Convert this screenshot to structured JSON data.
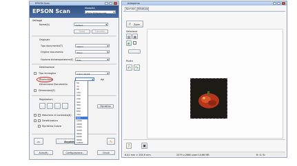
{
  "scan_window": {
    "title": "EPSON Scan",
    "brand": "EPSON Scan",
    "mode_label": "Modalità",
    "mode_value": "Modo Professionale",
    "settings_section": "Settaggi",
    "name_label": "Nome(A)",
    "name_value": "Default",
    "save_button": "Salva",
    "delete_button": "Cancella",
    "original_section": "Originale",
    "doc_type_label": "Tipo documento(T)",
    "doc_type_value": "Opaco",
    "doc_source_label": "Origine documento",
    "doc_source_value": "Piano",
    "auto_exposure_label": "Opzione Autoesposizione(E)",
    "auto_exposure_value": "Foto",
    "destination_section": "Destinazione",
    "image_type_label": "Tipo immagine",
    "image_type_value": "Colori 24-bit",
    "resolution_label": "Risoluzione",
    "resolution_unit": "dpi",
    "doc_size_label": "Dimensione Documento",
    "target_size_label": "Dimensioni(Z)",
    "adjustments_section": "Regolazioni",
    "reset_button": "Ripristina",
    "unsharp_label": "Maschera di contrasto(K)",
    "descreening_label": "Derettinatura",
    "color_restore_label": "Ripristino Colore",
    "scan_button": "Acquisisci",
    "help_button": "Aiuto(H)",
    "config_button": "Configurazione...",
    "close_button": "Chiudi",
    "resolution_options": [
      "50",
      "72",
      "96",
      "150",
      "200",
      "240",
      "300",
      "360",
      "400",
      "600",
      "720",
      "800",
      "1200",
      "1800",
      "2400",
      "3200",
      "4800",
      "6400",
      "9600",
      "12800"
    ],
    "resolution_selected_index": 11
  },
  "preview_window": {
    "title": "Anteprima",
    "tab_normal": "Normale",
    "tab_thumbnail": "Miniatura",
    "zoom_button": "Zoom",
    "selection_label": "Selezione",
    "rotate_label": "Ruota",
    "status_size": "6.41 mm × 204.6 mm",
    "status_pixels": "2079 x 2660 pixel 14.66 MB",
    "status_rgb": "R: G: B:"
  },
  "icons": {
    "zoom": "magnifier-icon",
    "marquee": "marquee-icon",
    "rotate_left": "rotate-left-icon",
    "rotate_right": "rotate-right-icon",
    "help": "help-icon",
    "scanner": "scanner-icon",
    "preview": "preview-icon"
  },
  "colors": {
    "selection_highlight": "#3d7bd6",
    "resolution_circle": "#d42020",
    "rotate_arrow": "#2f9a3a"
  }
}
